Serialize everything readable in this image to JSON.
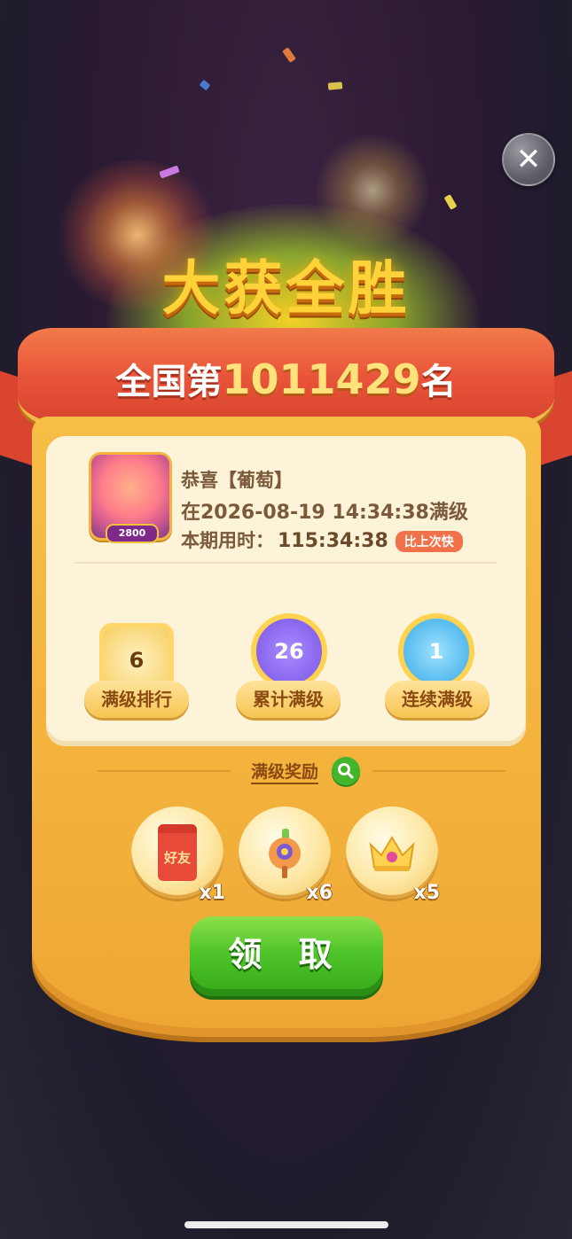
{
  "title": "大获全胜",
  "rank": {
    "prefix": "全国第",
    "number": "1011429",
    "suffix": "名"
  },
  "profile": {
    "avatar_badge": "2800",
    "greeting": "恭喜【葡萄】",
    "achieved": "在2026-08-19 14:34:38满级",
    "time_label": "本期用时：",
    "time_value": "115:34:38",
    "compare_badge": "比上次快"
  },
  "medals": [
    {
      "value": "6",
      "label": "满级排行"
    },
    {
      "value": "26",
      "label": "累计满级"
    },
    {
      "value": "1",
      "label": "连续满级"
    }
  ],
  "rewards": {
    "title": "满级奖励",
    "items": [
      {
        "icon": "red-packet-icon",
        "text": "好友",
        "qty": "x1"
      },
      {
        "icon": "magic-wand-icon",
        "qty": "x6"
      },
      {
        "icon": "crown-icon",
        "qty": "x5"
      }
    ]
  },
  "claim_label": "领 取",
  "colors": {
    "accent_green": "#4fc42a",
    "ribbon_red": "#e9553a",
    "gold": "#f3b23c"
  }
}
